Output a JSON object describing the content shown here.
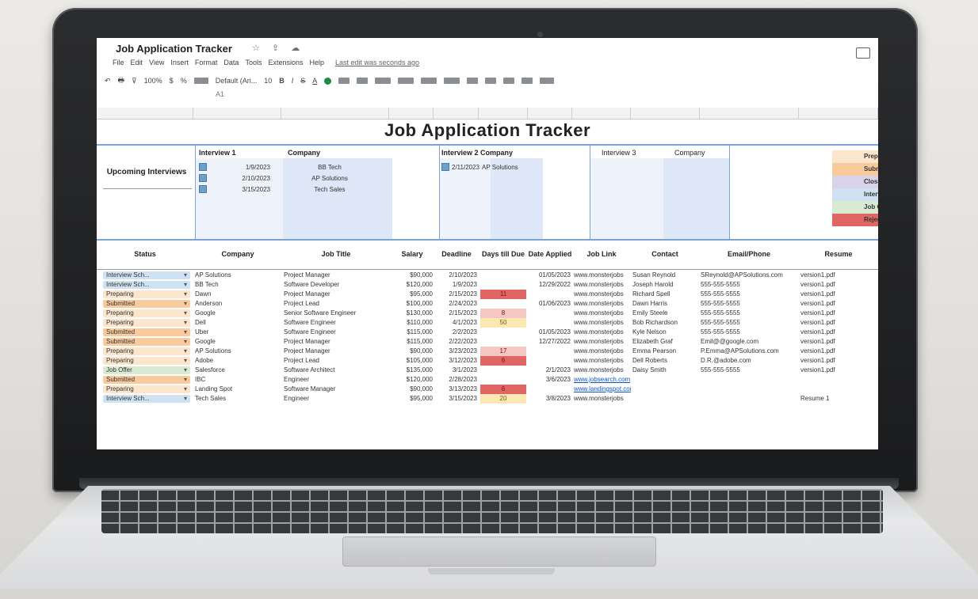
{
  "app": {
    "title": "Job Application Tracker",
    "title_icons": "☆ ⇪ ☁",
    "menu": [
      "File",
      "Edit",
      "View",
      "Insert",
      "Format",
      "Data",
      "Tools",
      "Extensions",
      "Help"
    ],
    "last_edit": "Last edit was seconds ago",
    "zoom": "100%",
    "font_name": "Default (Ari...",
    "font_size": "10",
    "cell_ref": "A1"
  },
  "sheet": {
    "title": "Job Application Tracker",
    "upcoming_label": "Upcoming Interviews",
    "interview_groups": [
      {
        "header_date": "Interview 1",
        "header_company": "Company",
        "rows": [
          {
            "date": "1/9/2023",
            "company": "BB Tech"
          },
          {
            "date": "2/10/2023",
            "company": "AP Solutions"
          },
          {
            "date": "3/15/2023",
            "company": "Tech Sales"
          }
        ]
      },
      {
        "header_date": "Interview 2",
        "header_company": "Company",
        "rows": [
          {
            "date": "2/11/2023",
            "company": "AP Solutions"
          }
        ]
      },
      {
        "header_date": "Interview 3",
        "header_company": "Company",
        "rows": []
      }
    ],
    "legend": [
      {
        "label": "Preparing",
        "color": "#fce5cd"
      },
      {
        "label": "Submitted",
        "color": "#f9cb9c"
      },
      {
        "label": "Closed",
        "color": "#d9d2e9"
      },
      {
        "label": "Interview Scheduled",
        "color": "#cfe2f3"
      },
      {
        "label": "Job Offer",
        "color": "#d9ead3"
      },
      {
        "label": "Rejected",
        "color": "#e06666"
      }
    ],
    "columns": [
      "Status",
      "Company",
      "Job Title",
      "Salary",
      "Deadline",
      "Days till Due",
      "Date Applied",
      "Job Link",
      "Contact",
      "Email/Phone",
      "Resume"
    ],
    "rows": [
      {
        "status": "Interview Sch...",
        "status_color": "#cfe2f3",
        "company": "AP Solutions",
        "title": "Project Manager",
        "salary": "$90,000",
        "deadline": "2/10/2023",
        "due": "",
        "due_style": "",
        "applied": "01/05/2023",
        "link": "www.monsterjobs",
        "contact": "Susan Reynold",
        "email": "SReynold@APSolutions.com",
        "resume": "version1.pdf"
      },
      {
        "status": "Interview Sch...",
        "status_color": "#cfe2f3",
        "company": "BB Tech",
        "title": "Software Developer",
        "salary": "$120,000",
        "deadline": "1/9/2023",
        "due": "",
        "due_style": "",
        "applied": "12/29/2022",
        "link": "www.monsterjobs",
        "contact": "Joseph Harold",
        "email": "555-555-5555",
        "resume": "version1.pdf"
      },
      {
        "status": "Preparing",
        "status_color": "#fce5cd",
        "company": "Dawn",
        "title": "Project Manager",
        "salary": "$95,000",
        "deadline": "2/15/2023",
        "due": "11",
        "due_style": "red",
        "applied": "",
        "link": "www.monsterjobs",
        "contact": "Richard Spell",
        "email": "555-555-5555",
        "resume": "version1.pdf"
      },
      {
        "status": "Submitted",
        "status_color": "#f9cb9c",
        "company": "Anderson",
        "title": "Project Lead",
        "salary": "$100,000",
        "deadline": "2/24/2023",
        "due": "",
        "due_style": "",
        "applied": "01/06/2023",
        "link": "www.monsterjobs",
        "contact": "Dawn Harris",
        "email": "555-555-5555",
        "resume": "version1.pdf"
      },
      {
        "status": "Preparing",
        "status_color": "#fce5cd",
        "company": "Google",
        "title": "Senior Software Engineer",
        "salary": "$130,000",
        "deadline": "2/15/2023",
        "due": "8",
        "due_style": "pink",
        "applied": "",
        "link": "www.monsterjobs",
        "contact": "Emily Steele",
        "email": "555-555-5555",
        "resume": "version1.pdf"
      },
      {
        "status": "Preparing",
        "status_color": "#fce5cd",
        "company": "Dell",
        "title": "Software Engineer",
        "salary": "$110,000",
        "deadline": "4/1/2023",
        "due": "50",
        "due_style": "amber",
        "applied": "",
        "link": "www.monsterjobs",
        "contact": "Bob Richardson",
        "email": "555-555-5555",
        "resume": "version1.pdf"
      },
      {
        "status": "Submitted",
        "status_color": "#f9cb9c",
        "company": "Uber",
        "title": "Software Engineer",
        "salary": "$115,000",
        "deadline": "2/2/2023",
        "due": "",
        "due_style": "",
        "applied": "01/05/2023",
        "link": "www.monsterjobs",
        "contact": "Kyle Nelson",
        "email": "555-555-5555",
        "resume": "version1.pdf"
      },
      {
        "status": "Submitted",
        "status_color": "#f9cb9c",
        "company": "Google",
        "title": "Project Manager",
        "salary": "$115,000",
        "deadline": "2/22/2023",
        "due": "",
        "due_style": "",
        "applied": "12/27/2022",
        "link": "www.monsterjobs",
        "contact": "Elizabeth Graf",
        "email": "Emil@@google.com",
        "resume": "version1.pdf"
      },
      {
        "status": "Preparing",
        "status_color": "#fce5cd",
        "company": "AP Solutions",
        "title": "Project Manager",
        "salary": "$90,000",
        "deadline": "3/23/2023",
        "due": "17",
        "due_style": "pink",
        "applied": "",
        "link": "www.monsterjobs",
        "contact": "Emma Pearson",
        "email": "P.Emma@APSolutions.com",
        "resume": "version1.pdf"
      },
      {
        "status": "Preparing",
        "status_color": "#fce5cd",
        "company": "Adobe",
        "title": "Project Lead",
        "salary": "$105,000",
        "deadline": "3/12/2023",
        "due": "6",
        "due_style": "red",
        "applied": "",
        "link": "www.monsterjobs",
        "contact": "Dell Roberts",
        "email": "D.R.@adobe.com",
        "resume": "version1.pdf"
      },
      {
        "status": "Job Offer",
        "status_color": "#d9ead3",
        "company": "Salesforce",
        "title": "Software Architect",
        "salary": "$135,000",
        "deadline": "3/1/2023",
        "due": "",
        "due_style": "",
        "applied": "2/1/2023",
        "link": "www.monsterjobs",
        "contact": "Daisy Smith",
        "email": "555-555-5555",
        "resume": "version1.pdf"
      },
      {
        "status": "Submitted",
        "status_color": "#f9cb9c",
        "company": "IBC",
        "title": "Engineer",
        "salary": "$120,000",
        "deadline": "2/28/2023",
        "due": "",
        "due_style": "",
        "applied": "3/6/2023",
        "link": "www.jobsearch.com",
        "contact": "",
        "email": "",
        "resume": ""
      },
      {
        "status": "Preparing",
        "status_color": "#fce5cd",
        "company": "Landing Spot",
        "title": "Software Manager",
        "salary": "$90,000",
        "deadline": "3/13/2023",
        "due": "6",
        "due_style": "red",
        "applied": "",
        "link": "www.landingspot.com",
        "contact": "",
        "email": "",
        "resume": ""
      },
      {
        "status": "Interview Sch...",
        "status_color": "#cfe2f3",
        "company": "Tech Sales",
        "title": "Engineer",
        "salary": "$95,000",
        "deadline": "3/15/2023",
        "due": "20",
        "due_style": "amber",
        "applied": "3/8/2023",
        "link": "www.monsterjobs",
        "contact": "",
        "email": "",
        "resume": "Resume 1"
      }
    ]
  }
}
